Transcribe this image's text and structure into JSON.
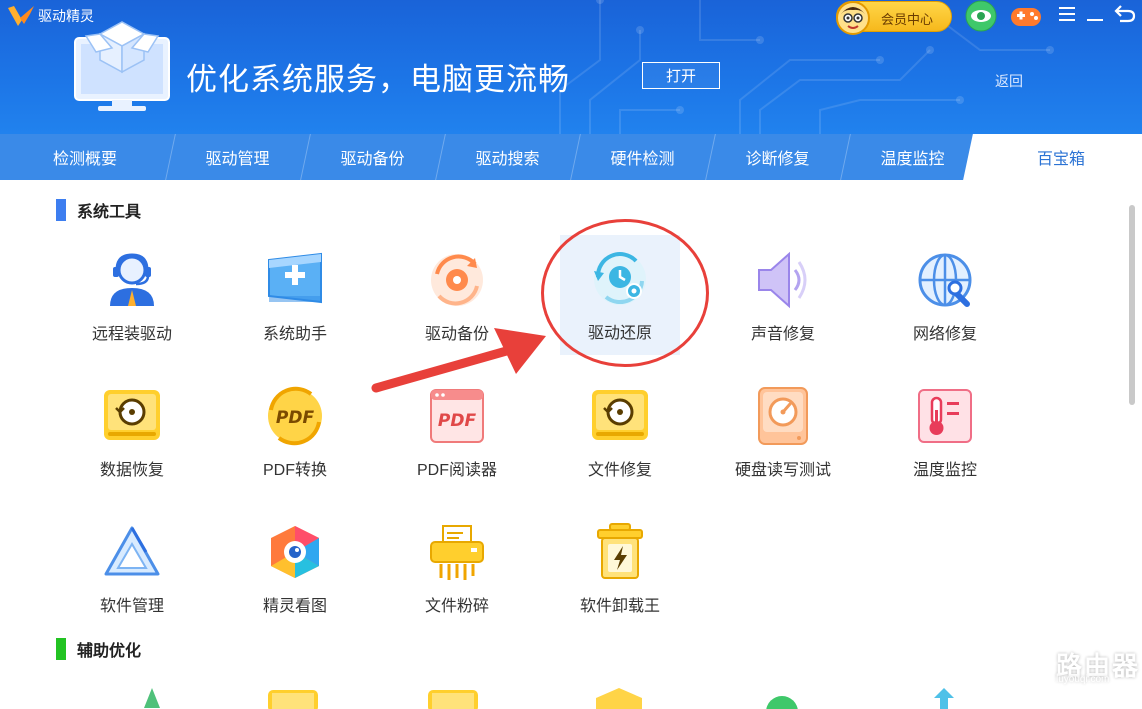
{
  "app": {
    "title": "驱动精灵"
  },
  "header": {
    "banner_text": "优化系统服务，电脑更流畅",
    "open_label": "打开",
    "back_label": "返回",
    "vip_label": "会员中心"
  },
  "nav": {
    "tabs": [
      {
        "label": "检测概要"
      },
      {
        "label": "驱动管理"
      },
      {
        "label": "驱动备份"
      },
      {
        "label": "驱动搜索"
      },
      {
        "label": "硬件检测"
      },
      {
        "label": "诊断修复"
      },
      {
        "label": "温度监控"
      },
      {
        "label": "百宝箱"
      }
    ]
  },
  "sections": {
    "system_tools": {
      "title": "系统工具"
    },
    "aux_opt": {
      "title": "辅助优化"
    }
  },
  "tools": [
    {
      "label": "远程装驱动",
      "icon": "remote-support-icon"
    },
    {
      "label": "系统助手",
      "icon": "windows-assistant-icon"
    },
    {
      "label": "驱动备份",
      "icon": "driver-backup-icon"
    },
    {
      "label": "驱动还原",
      "icon": "driver-restore-icon"
    },
    {
      "label": "声音修复",
      "icon": "speaker-icon"
    },
    {
      "label": "网络修复",
      "icon": "network-globe-icon"
    },
    {
      "label": "数据恢复",
      "icon": "data-recovery-icon"
    },
    {
      "label": "PDF转换",
      "icon": "pdf-convert-icon"
    },
    {
      "label": "PDF阅读器",
      "icon": "pdf-reader-icon"
    },
    {
      "label": "文件修复",
      "icon": "file-repair-icon"
    },
    {
      "label": "硬盘读写测试",
      "icon": "disk-speed-icon"
    },
    {
      "label": "温度监控",
      "icon": "thermometer-icon"
    },
    {
      "label": "软件管理",
      "icon": "software-manager-icon"
    },
    {
      "label": "精灵看图",
      "icon": "image-viewer-icon"
    },
    {
      "label": "文件粉碎",
      "icon": "file-shredder-icon"
    },
    {
      "label": "软件卸载王",
      "icon": "uninstaller-icon"
    }
  ],
  "pdf_badge": "PDF",
  "watermark": {
    "text": "路由器",
    "sub": "luyouqi.com"
  },
  "colors": {
    "header_blue": "#1c74e6",
    "nav_blue": "#3a8ae8",
    "active_tab_text": "#2b73d4",
    "section_bar_blue": "#3d7ef0",
    "section_bar_green": "#22c322",
    "annotation_red": "#e8403a",
    "vip_gold": "#f6b81c"
  }
}
